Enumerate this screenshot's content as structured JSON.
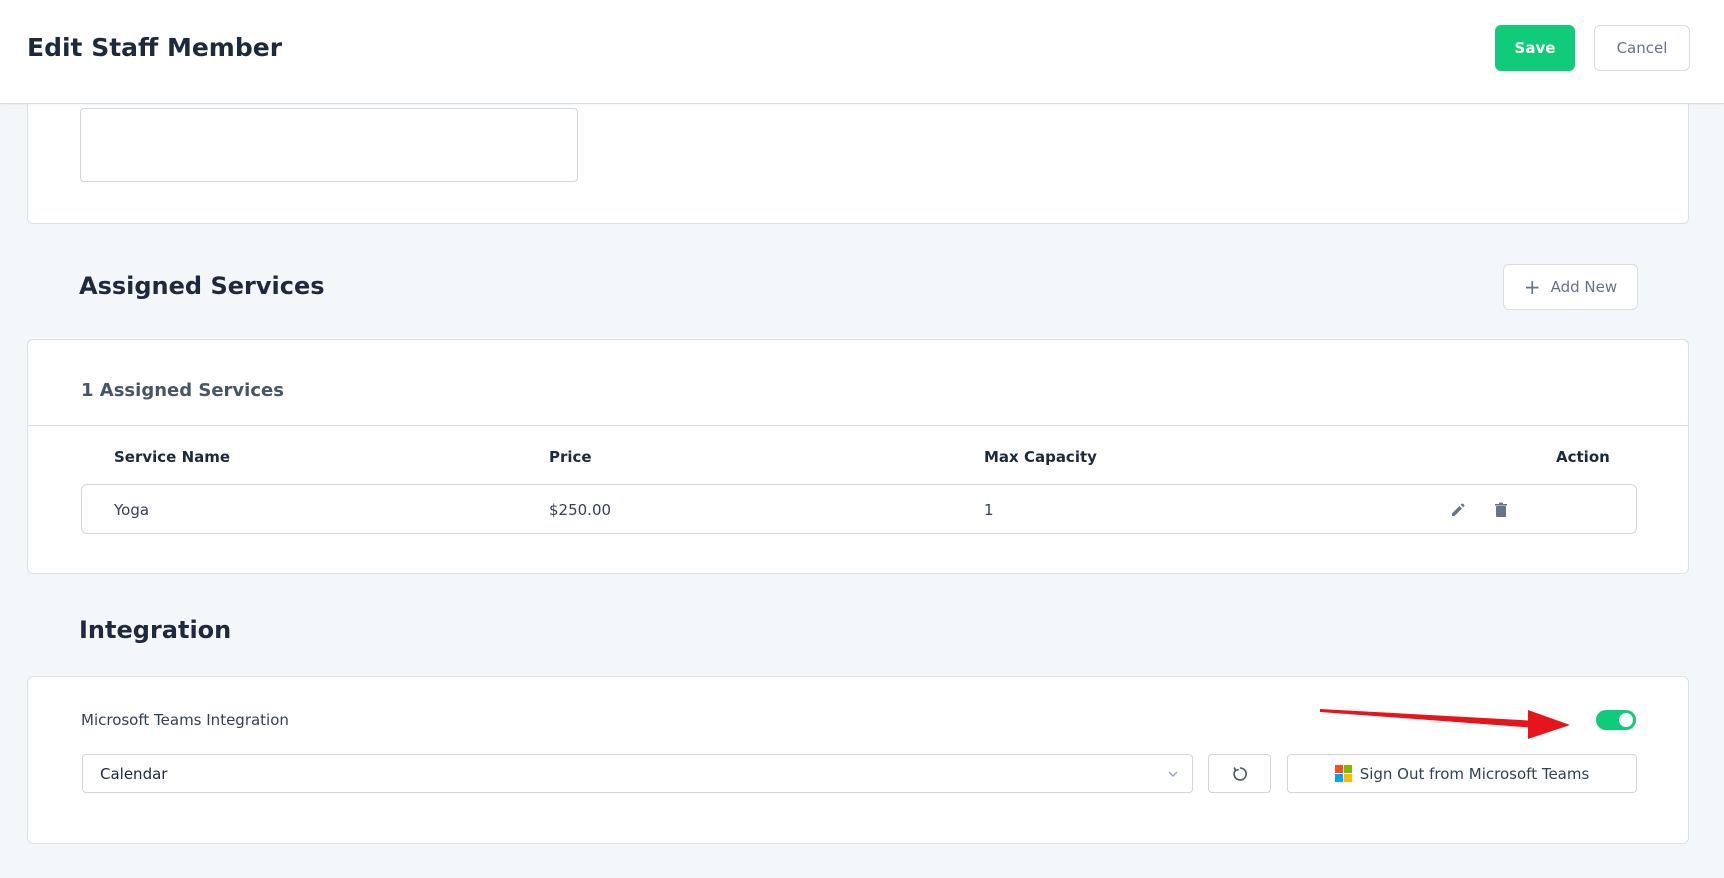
{
  "header": {
    "title": "Edit Staff Member",
    "save_label": "Save",
    "cancel_label": "Cancel"
  },
  "assigned_services": {
    "title": "Assigned Services",
    "add_new_label": "Add New",
    "count_label": "1 Assigned Services",
    "columns": [
      "Service Name",
      "Price",
      "Max Capacity",
      "Action"
    ],
    "rows": [
      {
        "service_name": "Yoga",
        "price": "$250.00",
        "max_capacity": "1"
      }
    ]
  },
  "integration": {
    "title": "Integration",
    "teams_label": "Microsoft Teams Integration",
    "toggle_enabled": true,
    "calendar_selected": "Calendar",
    "sign_out_label": "Sign Out from Microsoft Teams"
  },
  "colors": {
    "accent": "#10cc7a",
    "annotation_arrow": "#e8141c",
    "ms_red": "#f25022",
    "ms_green": "#7fba00",
    "ms_blue": "#00a4ef",
    "ms_yellow": "#ffb900"
  },
  "icons": {
    "add": "plus-icon",
    "edit": "pencil-icon",
    "delete": "trash-icon",
    "refresh": "refresh-icon",
    "dropdown": "chevron-down-icon",
    "microsoft": "microsoft-logo-icon"
  }
}
